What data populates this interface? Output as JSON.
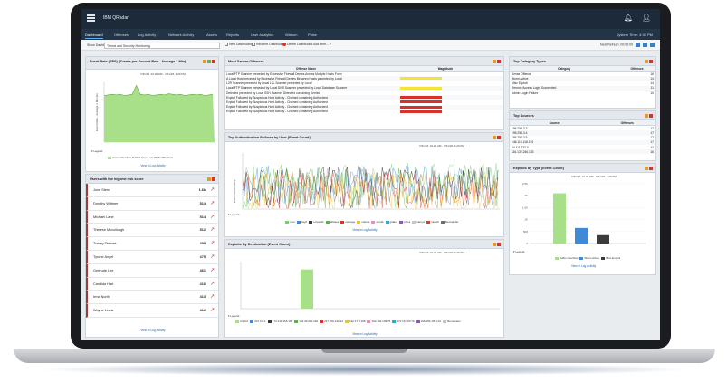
{
  "app": {
    "title": "IBM QRadar",
    "system_time": "System Time: 4:30 PM"
  },
  "nav": {
    "tabs": [
      "Dashboard",
      "Offenses",
      "Log Activity",
      "Network Activity",
      "Assets",
      "Reports",
      "User Analytics",
      "Watson",
      "Pulse"
    ],
    "active": "Dashboard"
  },
  "toolbar": {
    "show_label": "Show Dashboard:",
    "dashboard_value": "Threat and Security Monitoring",
    "new_dashboard": "New Dashboard",
    "rename_dashboard": "Rename Dashboard",
    "delete_dashboard": "Delete Dashboard",
    "add_item": "Add Item...",
    "next_refresh": "Next Refresh: 00:00:00"
  },
  "event_rate": {
    "title": "Event Rate (EPS) (Events per Second Raw - Average 1 Min)",
    "timestamp": "7/31/18, 10:20 AM - 7/31/18, 4:20 PM",
    "ylabel": "Event Rate - Average 1 Min (Ev",
    "legend_label": "Legend",
    "legend_item": "ariel.mnbcr.dcm.bl.53.6 tcm.ra.mc.2079.ctbbeteml",
    "link": "View in Log Activity",
    "colors": {
      "area": "#a8e08a",
      "line": "#5aa83a"
    }
  },
  "risk_users": {
    "title": "Users with the highest risk score",
    "link": "View in Log Activity",
    "rows": [
      {
        "name": "Jone Stern",
        "score": "1.6k"
      },
      {
        "name": "Dorothy Wittmer",
        "score": "514"
      },
      {
        "name": "Michael Lane",
        "score": "514"
      },
      {
        "name": "Therese Mccullough",
        "score": "512"
      },
      {
        "name": "Tracey Stewart",
        "score": "495"
      },
      {
        "name": "Tyrone Angel",
        "score": "475"
      },
      {
        "name": "Gertrude Lee",
        "score": "461"
      },
      {
        "name": "Candida Hart",
        "score": "416"
      },
      {
        "name": "Irma North",
        "score": "413"
      },
      {
        "name": "Wayne Lewis",
        "score": "412"
      }
    ]
  },
  "offenses": {
    "title": "Most Severe Offenses",
    "col_name": "Offense Name",
    "col_mag": "Magnitude",
    "rows": [
      {
        "name": "Local FTP Scanner preceded by Excessive Firewall Denies Across Multiple Hosts From",
        "mag": ""
      },
      {
        "name": "A Local Host preceded by Excessive Firewall Denies Between Hosts preceded by Local",
        "mag": "yellow"
      },
      {
        "name": "L2R Scanner preceded by Local L2L Scanner preceded by Local",
        "mag": ""
      },
      {
        "name": "Local FTP Scanner preceded by Local DNS Scanner preceded by Local Database Scanner",
        "mag": "yellow"
      },
      {
        "name": "Detected preceded by Local SSH Scanner Detected containing Denied",
        "mag": ""
      },
      {
        "name": "Exploit Followed by Suspicious Host Activity - Chained containing Authorized",
        "mag": "red"
      },
      {
        "name": "Exploit Followed by Suspicious Host Activity - Chained containing Authorized",
        "mag": "red"
      },
      {
        "name": "Exploit Followed by Suspicious Host Activity - Chained containing Authorized",
        "mag": "red"
      },
      {
        "name": "Exploit Followed by Suspicious Host Activity - Chained containing Authorized",
        "mag": "red"
      }
    ]
  },
  "auth_fail": {
    "title": "Top Authentication Failures by User (Event Count)",
    "timestamp": "7/31/18, 10:20 AM - 7/31/18, 4:20 PM",
    "ylabel": "Event Count (Sum)",
    "legend_label": "Legend",
    "legend": [
      {
        "label": "root",
        "color": "#7ec97e"
      },
      {
        "label": "bayd",
        "color": "#3f8ad6"
      },
      {
        "label": "ermandc",
        "color": "#3b3b3b"
      },
      {
        "label": "atlases",
        "color": "#5ab14a"
      },
      {
        "label": "eacarge",
        "color": "#d9322b"
      },
      {
        "label": "marote",
        "color": "#f2c12e"
      },
      {
        "label": "enmik",
        "color": "#e78fbf"
      },
      {
        "label": "gldam",
        "color": "#2fa9c9"
      },
      {
        "label": "mbr.a",
        "color": "#8c5ab0"
      },
      {
        "label": "carnys",
        "color": "#c7c7c7"
      },
      {
        "label": "mkacb",
        "color": "#b84a3a"
      },
      {
        "label": "Remainder",
        "color": "#6f6f6f"
      }
    ],
    "link": "View in Log Activity"
  },
  "exploits_dest": {
    "title": "Exploits By Destination (Event Count)",
    "timestamp": "7/31/18, 10:20 AM - 7/31/18, 4:20 PM",
    "legend_label": "Legend",
    "legend": [
      {
        "label": "0.0.0.0",
        "color": "#a8e08a"
      },
      {
        "label": "247.0.0.1",
        "color": "#3f8ad6"
      },
      {
        "label": "174.136.156.195",
        "color": "#3b3b3b"
      },
      {
        "label": "194.39.210.193",
        "color": "#5ab14a"
      },
      {
        "label": "217.200.210.44",
        "color": "#d9322b"
      },
      {
        "label": "192.17.8.168",
        "color": "#f2c12e"
      },
      {
        "label": "192.192.193.76",
        "color": "#e78fbf"
      },
      {
        "label": "172.16.200.79",
        "color": "#2fa9c9"
      },
      {
        "label": "196.196.195.101",
        "color": "#8c5ab0"
      },
      {
        "label": "Remainder",
        "color": "#c7c7c7"
      }
    ],
    "link": "View in Log Activity",
    "colors": {
      "bar": "#a8e08a"
    }
  },
  "categories": {
    "title": "Top Category Types",
    "col_cat": "Category",
    "col_off": "Offenses",
    "rows": [
      {
        "category": "Sense Offense",
        "offenses": "16"
      },
      {
        "category": "Worm Active",
        "offenses": "14"
      },
      {
        "category": "Misc Exploit",
        "offenses": "14"
      },
      {
        "category": "Remote Access Login Succeeded",
        "offenses": "11"
      },
      {
        "category": "Admin Login Failure",
        "offenses": "10"
      }
    ]
  },
  "sources": {
    "title": "Top Sources",
    "col_src": "Source",
    "col_off": "Offenses",
    "rows": [
      {
        "source": "195.254.3.3",
        "offenses": "17"
      },
      {
        "source": "195.254.3.4",
        "offenses": "17"
      },
      {
        "source": "195.254.3.5",
        "offenses": "17"
      },
      {
        "source": "146.116.118.191",
        "offenses": "17"
      },
      {
        "source": "84.111.222.0",
        "offenses": "17"
      },
      {
        "source": "116.132.246.133",
        "offenses": "16"
      }
    ]
  },
  "exploits_type": {
    "title": "Exploits by Type (Event Count)",
    "timestamp": "7/31/18, 10:20 AM - 7/31/18, 4:20 PM",
    "legend_label": "Legend",
    "link": "View in Log Activity",
    "y_ticks": [
      "2.5K",
      "2K",
      "1.5K",
      "1K",
      "500",
      "0"
    ]
  },
  "chart_data": [
    {
      "type": "area",
      "title": "Event Rate (EPS) (Events per Second Raw - Average 1 Min)",
      "ylabel": "Event Rate - Average 1 Min (Ev",
      "series": [
        {
          "name": "ariel.mnbcr.dcm.bl.53.6 tcm.ra.mc.2079.ctbbeteml",
          "values": [
            0.78,
            0.79,
            0.8,
            0.79,
            0.8,
            0.78,
            0.79,
            0.8,
            0.95,
            0.8,
            0.79,
            0.8,
            0.78,
            0.79,
            0.8,
            0.79,
            0.81,
            0.8,
            0.79,
            0.8,
            0.78,
            0.79,
            0.8,
            0.79,
            0.8,
            0.78,
            0.79,
            0.8
          ]
        }
      ]
    },
    {
      "type": "bar",
      "title": "Exploits by Type (Event Count)",
      "categories": [
        "Buffer Overflow",
        "Worm Active",
        "Misc Exploit"
      ],
      "values": [
        2100,
        650,
        350
      ],
      "ylim": [
        0,
        2500
      ]
    },
    {
      "type": "bar",
      "title": "Exploits By Destination (Event Count)",
      "categories": [
        "0.0.0.0"
      ],
      "values": [
        1
      ],
      "ylim": [
        0,
        1.2
      ]
    }
  ]
}
